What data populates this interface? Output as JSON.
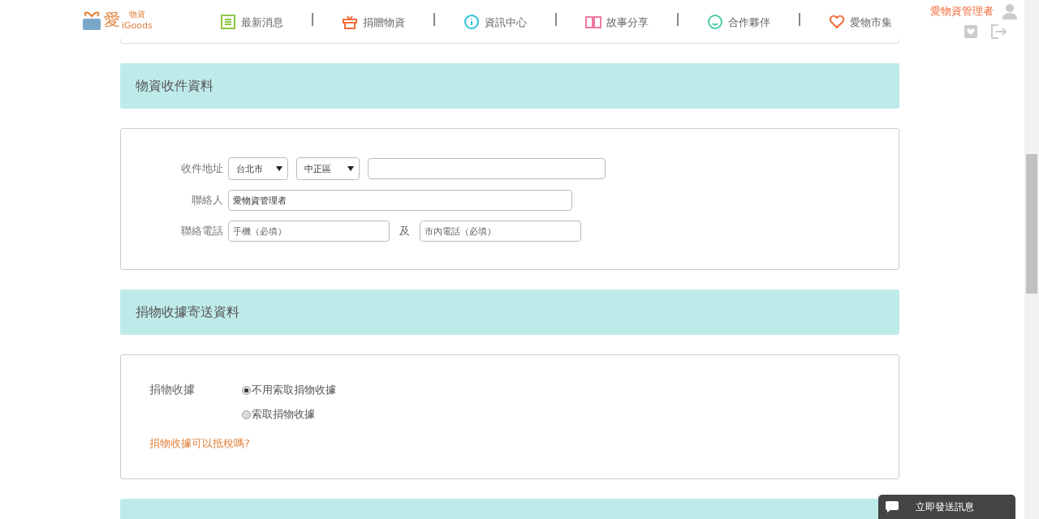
{
  "logo": {
    "main": "愛",
    "sub": "物資",
    "brand": "iGoods"
  },
  "nav": [
    {
      "kind": "news",
      "label": "最新消息",
      "color": "#8cc63f"
    },
    {
      "kind": "donate",
      "label": "捐贈物資",
      "color": "#f26b3a"
    },
    {
      "kind": "info",
      "label": "資訊中心",
      "color": "#29c0d8"
    },
    {
      "kind": "story",
      "label": "故事分享",
      "color": "#f07aa0"
    },
    {
      "kind": "partner",
      "label": "合作夥伴",
      "color": "#4cc9a7"
    },
    {
      "kind": "market",
      "label": "愛物市集",
      "color": "#f26b3a"
    }
  ],
  "user": {
    "name": "愛物資管理者"
  },
  "sections": [
    {
      "kind": "address",
      "title": "物資收件資料",
      "address_label": "收件地址",
      "city": "台北市",
      "district": "中正區",
      "contact_label": "聯絡人",
      "contact": "愛物資管理者",
      "phone_label": "聯絡電話",
      "mobile_placeholder": "手機（必填）",
      "and": "及",
      "landline_placeholder": "市內電話（必填）"
    },
    {
      "kind": "receipt",
      "title": "捐物收據寄送資料",
      "label": "捐物收據",
      "options": [
        {
          "label": "不用索取捐物收據",
          "selected": true
        },
        {
          "label": "索取捐物收據",
          "selected": false
        }
      ],
      "link": "捐物收據可以抵稅嗎?"
    }
  ],
  "chat": {
    "label": "立即發送訊息"
  }
}
